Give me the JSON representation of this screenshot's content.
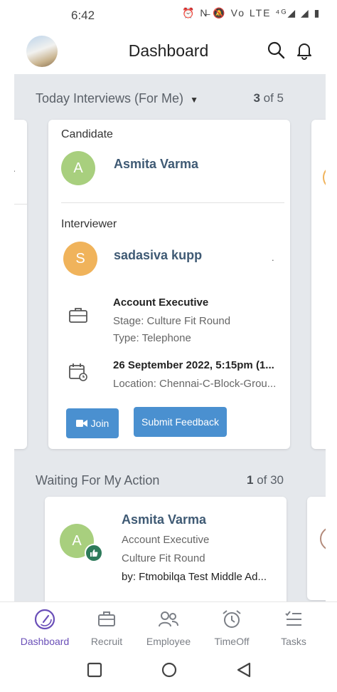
{
  "status_bar": {
    "time": "6:42",
    "icons_text": "⏰ N̶ 🔕 Vo LTE ⁴ᴳ◢ ◢ ▮"
  },
  "app_bar": {
    "title": "Dashboard"
  },
  "today_section": {
    "title": "Today Interviews (For Me)",
    "count_current": "3",
    "count_rest": "of 5"
  },
  "interview_card": {
    "candidate_label": "Candidate",
    "candidate_initial": "A",
    "candidate_name": "Asmita Varma",
    "interviewer_label": "Interviewer",
    "interviewer_initial": "S",
    "interviewer_name": "sadasiva kupp",
    "job_title": "Account Executive",
    "stage": "Stage: Culture Fit Round",
    "type": "Type: Telephone",
    "datetime": "26 September 2022, 5:15pm (1...",
    "location": "Location: Chennai-C-Block-Grou...",
    "join_label": "Join",
    "feedback_label": "Submit Feedback"
  },
  "waiting_section": {
    "title": "Waiting For My Action",
    "count_current": "1",
    "count_rest": "of 30"
  },
  "action_card": {
    "initial": "A",
    "name": "Asmita Varma",
    "job_title": "Account Executive",
    "stage": "Culture Fit Round",
    "by": "by: Ftmobilqa Test Middle Ad..."
  },
  "bottom_nav": {
    "items": [
      {
        "label": "Dashboard",
        "icon": "dashboard-gauge-icon",
        "active": true
      },
      {
        "label": "Recruit",
        "icon": "briefcase-icon",
        "active": false
      },
      {
        "label": "Employee",
        "icon": "people-icon",
        "active": false
      },
      {
        "label": "TimeOff",
        "icon": "alarm-clock-icon",
        "active": false
      },
      {
        "label": "Tasks",
        "icon": "checklist-icon",
        "active": false
      }
    ]
  },
  "colors": {
    "accent": "#6a4fb8",
    "button": "#4a90d0",
    "green_avatar": "#a8cf7e",
    "orange_avatar": "#f0b35b",
    "name_text": "#3f5a74"
  }
}
